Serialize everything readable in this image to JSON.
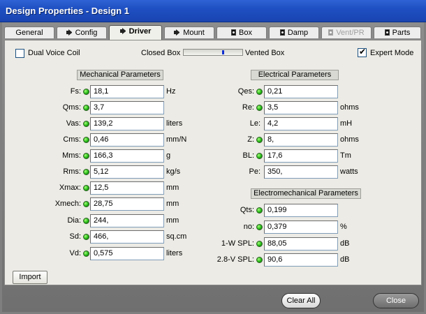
{
  "window": {
    "title": "Design Properties - Design 1"
  },
  "tabs": [
    {
      "label": "General",
      "icon": "none",
      "active": false,
      "disabled": false
    },
    {
      "label": "Config",
      "icon": "speaker-icon",
      "active": false,
      "disabled": false
    },
    {
      "label": "Driver",
      "icon": "speaker-icon",
      "active": true,
      "disabled": false
    },
    {
      "label": "Mount",
      "icon": "speaker-icon",
      "active": false,
      "disabled": false
    },
    {
      "label": "Box",
      "icon": "box-icon",
      "active": false,
      "disabled": false
    },
    {
      "label": "Damp",
      "icon": "box-icon",
      "active": false,
      "disabled": false
    },
    {
      "label": "Vent/PR",
      "icon": "box-icon",
      "active": false,
      "disabled": true
    },
    {
      "label": "Parts",
      "icon": "box-icon",
      "active": false,
      "disabled": false
    }
  ],
  "options": {
    "dual_voice_coil": {
      "label": "Dual Voice Coil",
      "checked": false
    },
    "box_type": {
      "left_label": "Closed Box",
      "right_label": "Vented Box",
      "position": 0.68
    },
    "expert_mode": {
      "label": "Expert Mode",
      "checked": true
    }
  },
  "mechanical": {
    "header": "Mechanical Parameters",
    "rows": [
      {
        "label": "Fs:",
        "value": "18,1",
        "unit": "Hz"
      },
      {
        "label": "Qms:",
        "value": "3,7",
        "unit": ""
      },
      {
        "label": "Vas:",
        "value": "139,2",
        "unit": "liters"
      },
      {
        "label": "Cms:",
        "value": "0,46",
        "unit": "mm/N"
      },
      {
        "label": "Mms:",
        "value": "166,3",
        "unit": "g"
      },
      {
        "label": "Rms:",
        "value": "5,12",
        "unit": "kg/s"
      },
      {
        "label": "Xmax:",
        "value": "12,5",
        "unit": "mm"
      },
      {
        "label": "Xmech:",
        "value": "28,75",
        "unit": "mm"
      },
      {
        "label": "Dia:",
        "value": "244,",
        "unit": "mm"
      },
      {
        "label": "Sd:",
        "value": "466,",
        "unit": "sq.cm"
      },
      {
        "label": "Vd:",
        "value": "0,575",
        "unit": "liters"
      }
    ]
  },
  "electrical": {
    "header": "Electrical Parameters",
    "rows": [
      {
        "label": "Qes:",
        "value": "0,21",
        "unit": ""
      },
      {
        "label": "Re:",
        "value": "3,5",
        "unit": "ohms"
      },
      {
        "label": "Le:",
        "value": "4,2",
        "unit": "mH"
      },
      {
        "label": "Z:",
        "value": "8,",
        "unit": "ohms"
      },
      {
        "label": "BL:",
        "value": "17,6",
        "unit": "Tm"
      },
      {
        "label": "Pe:",
        "value": "350,",
        "unit": "watts"
      }
    ]
  },
  "electromechanical": {
    "header": "Electromechanical Parameters",
    "rows": [
      {
        "label": "Qts:",
        "value": "0,199",
        "unit": ""
      },
      {
        "label": "no:",
        "value": "0,379",
        "unit": "%"
      },
      {
        "label": "1-W SPL:",
        "value": "88,05",
        "unit": "dB"
      },
      {
        "label": "2.8-V SPL:",
        "value": "90,6",
        "unit": "dB"
      }
    ]
  },
  "buttons": {
    "import": "Import",
    "clear_all": "Clear All",
    "close": "Close"
  },
  "colors": {
    "titlebar": "#1e4fc2",
    "led": "#22b814",
    "slider_thumb": "#1030d0"
  }
}
